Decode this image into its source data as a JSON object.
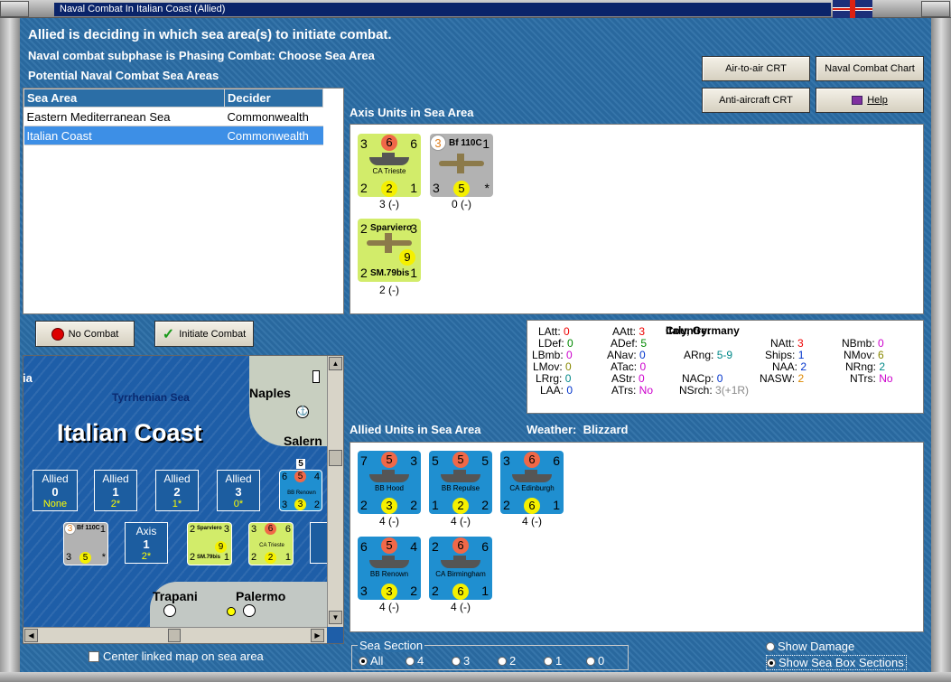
{
  "window": {
    "title": "Naval Combat In Italian Coast (Allied)"
  },
  "header": {
    "line1": "Allied is deciding in which sea area(s) to initiate combat.",
    "line2": "Naval combat subphase is Phasing Combat: Choose Sea Area",
    "line3": "Potential Naval Combat Sea Areas"
  },
  "buttons": {
    "air_to_air": "Air-to-air CRT",
    "naval_chart": "Naval Combat Chart",
    "anti_aircraft": "Anti-aircraft CRT",
    "help": "Help",
    "no_combat": "No Combat",
    "initiate": "Initiate Combat"
  },
  "sea_table": {
    "headers": [
      "Sea Area",
      "Decider"
    ],
    "rows": [
      [
        "Eastern Mediterranean Sea",
        "Commonwealth"
      ],
      [
        "Italian Coast",
        "Commonwealth"
      ]
    ]
  },
  "axis_section": {
    "title": "Axis Units in Sea Area"
  },
  "axis_units": [
    {
      "tl": "3",
      "tc": "6",
      "tr": "6",
      "name": "CA Trieste",
      "bl": "2",
      "bc": "2",
      "br": "1",
      "label": "3 (-)"
    },
    {
      "tl": "3",
      "tc": "Bf 110C",
      "tr": "1",
      "bl": "3",
      "bc": "5",
      "br": "*",
      "label": "0 (-)"
    },
    {
      "tl": "2",
      "tc": "Sparviero",
      "tr": "3",
      "name": "SM.79bis",
      "bl": "2",
      "bc": "9",
      "br": "1",
      "label": "2 (-)"
    }
  ],
  "stats": {
    "LAtt": "0",
    "LDef": "0",
    "LBmb": "0",
    "LMov": "0",
    "LRrg": "0",
    "LAA": "0",
    "AAtt": "3",
    "ADef": "5",
    "ANav": "0",
    "ATac": "0",
    "AStr": "0",
    "ATrs": "No",
    "country_label": "Country:",
    "country": "Italy, Germany",
    "ARng": "5-9",
    "NACp": "0",
    "NSrch": "3(+1R)",
    "NAtt": "3",
    "Ships": "1",
    "NAA": "2",
    "NASW": "2",
    "NBmb": "0",
    "NMov": "6",
    "NRng": "2",
    "NTrs": "No"
  },
  "allied_section": {
    "title": "Allied Units in Sea Area",
    "weather_label": "Weather:",
    "weather": "Blizzard"
  },
  "allied_units": [
    {
      "tl": "7",
      "tc": "5",
      "tr": "3",
      "name": "BB Hood",
      "bl": "2",
      "bc": "3",
      "br": "2",
      "label": "4 (-)"
    },
    {
      "tl": "5",
      "tc": "5",
      "tr": "5",
      "name": "BB Repulse",
      "bl": "1",
      "bc": "2",
      "br": "2",
      "label": "4 (-)"
    },
    {
      "tl": "3",
      "tc": "6",
      "tr": "6",
      "name": "CA Edinburgh",
      "bl": "2",
      "bc": "6",
      "br": "1",
      "label": "4 (-)"
    },
    {
      "tl": "6",
      "tc": "5",
      "tr": "4",
      "name": "BB Renown",
      "bl": "3",
      "bc": "3",
      "br": "2",
      "label": "4 (-)"
    },
    {
      "tl": "2",
      "tc": "6",
      "tr": "6",
      "name": "CA Birmingham",
      "bl": "2",
      "bc": "6",
      "br": "1",
      "label": "4 (-)"
    }
  ],
  "map": {
    "title": "Italian Coast",
    "sea": "Tyrrhenian Sea",
    "naples": "Naples",
    "salerno": "Salern",
    "trapani": "Trapani",
    "palermo": "Palermo",
    "edge": "ia",
    "boxes_allied": [
      {
        "side": "Allied",
        "n": "0",
        "v": "None"
      },
      {
        "side": "Allied",
        "n": "1",
        "v": "2*"
      },
      {
        "side": "Allied",
        "n": "2",
        "v": "1*"
      },
      {
        "side": "Allied",
        "n": "3",
        "v": "0*"
      }
    ],
    "box_axis": {
      "side": "Axis",
      "n": "1",
      "v": "2*"
    },
    "box_num": "5",
    "renown_mini": {
      "tl": "6",
      "tc": "5",
      "tr": "4",
      "name": "BB Renown",
      "bl": "3",
      "bc": "3",
      "br": "2"
    },
    "bf_mini": {
      "tl": "3",
      "tc": "Bf 110C",
      "tr": "1",
      "bl": "3",
      "bc": "5",
      "br": "*"
    },
    "sm_mini": {
      "tl": "2",
      "tc": "Sparviero",
      "tr": "3",
      "name": "SM.79bis",
      "bl": "2",
      "bc": "9",
      "br": "1"
    },
    "trieste_mini": {
      "tl": "3",
      "tc": "6",
      "tr": "6",
      "name": "CA Trieste",
      "bl": "2",
      "bc": "2",
      "br": "1"
    }
  },
  "center_map": "Center linked map on sea area",
  "sea_section": {
    "legend": "Sea Section",
    "options": [
      "All",
      "4",
      "3",
      "2",
      "1",
      "0"
    ],
    "selected": "All"
  },
  "display": {
    "show_damage": "Show Damage",
    "show_sea_box": "Show Sea Box Sections"
  },
  "colors": {
    "panel_bg": "#2b6ea6",
    "selection": "#3d8fe6",
    "counter_axis": "#d2ec6a",
    "counter_allied": "#1f8fd0"
  }
}
